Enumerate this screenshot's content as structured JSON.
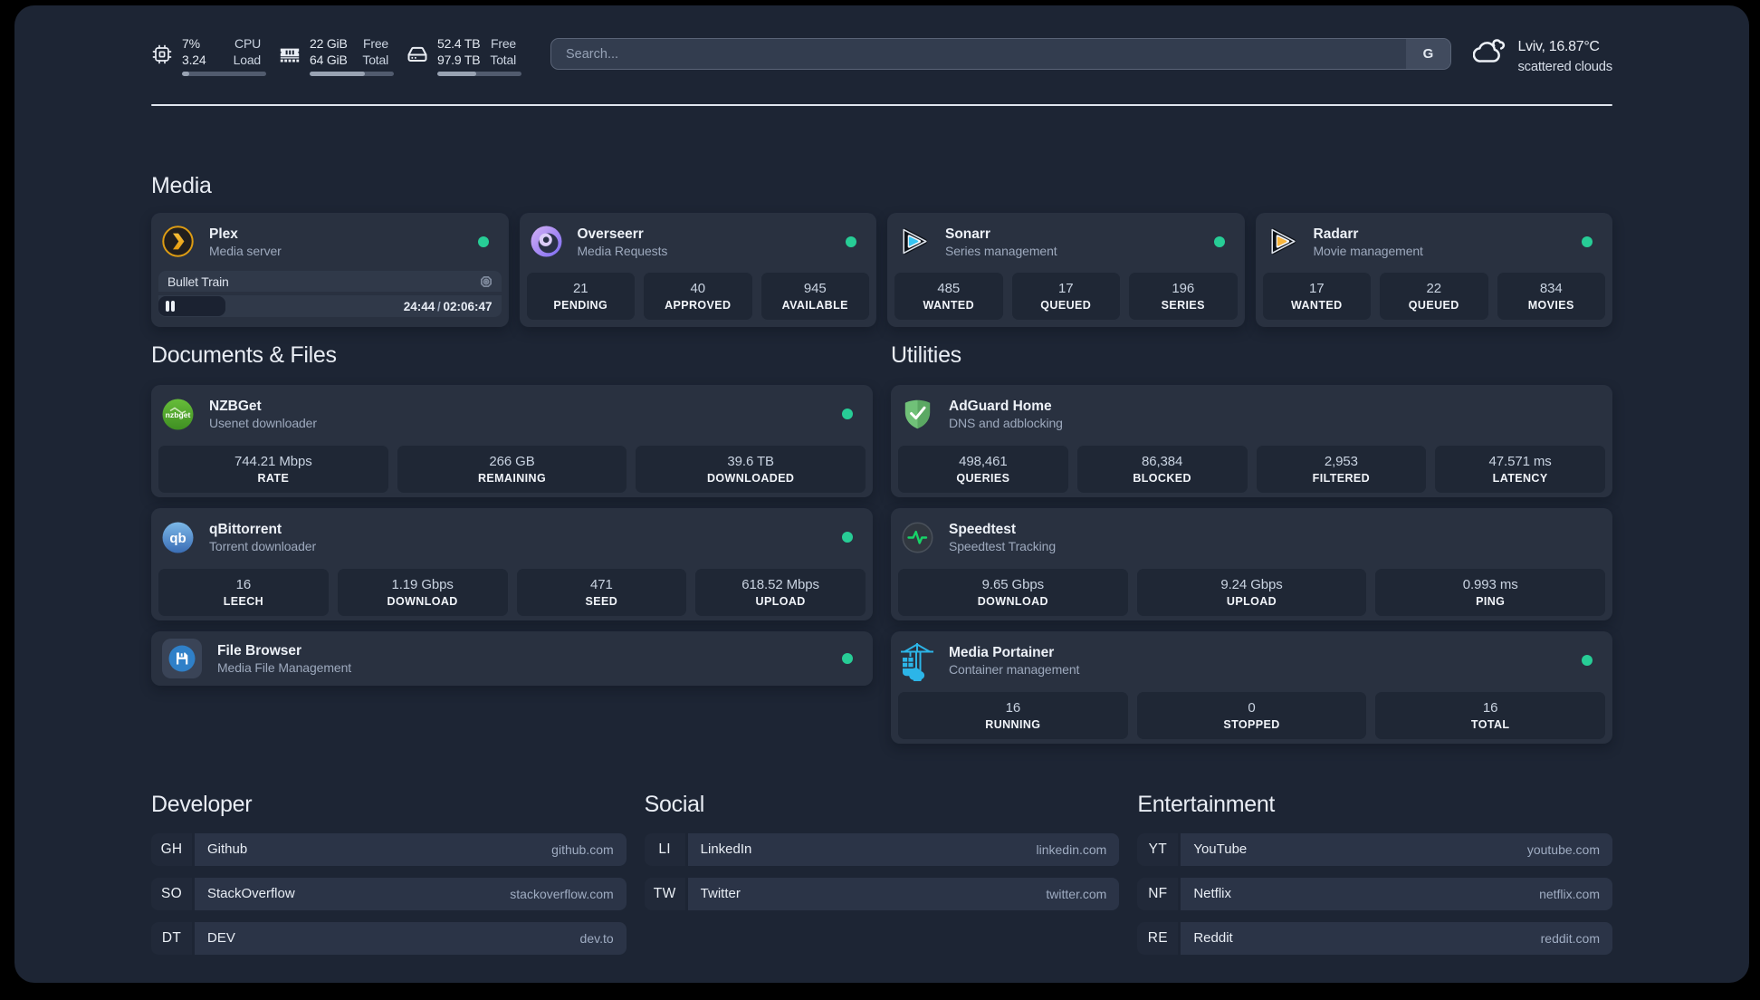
{
  "topbar": {
    "resources": [
      {
        "icon": "cpu-icon",
        "values": [
          "7%",
          "3.24"
        ],
        "labels": [
          "CPU",
          "Load"
        ],
        "progress_pct": 9
      },
      {
        "icon": "memory-icon",
        "values": [
          "22 GiB",
          "64 GiB"
        ],
        "labels": [
          "Free",
          "Total"
        ],
        "progress_pct": 66
      },
      {
        "icon": "disk-icon",
        "values": [
          "52.4 TB",
          "97.9 TB"
        ],
        "labels": [
          "Free",
          "Total"
        ],
        "progress_pct": 46
      }
    ],
    "search": {
      "placeholder": "Search...",
      "provider_button": "G"
    },
    "weather": {
      "location_temp": "Lviv, 16.87°C",
      "condition": "scattered clouds"
    }
  },
  "groups": {
    "media": {
      "title": "Media",
      "services": [
        {
          "name": "Plex",
          "description": "Media server",
          "icon": "plex-icon",
          "online": true,
          "player": {
            "title": "Bullet Train",
            "elapsed": "24:44",
            "separator": "/",
            "duration": "02:06:47",
            "progress_pct": 19.6
          }
        },
        {
          "name": "Overseerr",
          "description": "Media Requests",
          "icon": "overseerr-icon",
          "online": true,
          "stats": [
            {
              "value": "21",
              "label": "PENDING"
            },
            {
              "value": "40",
              "label": "APPROVED"
            },
            {
              "value": "945",
              "label": "AVAILABLE"
            }
          ]
        },
        {
          "name": "Sonarr",
          "description": "Series management",
          "icon": "sonarr-icon",
          "online": true,
          "stats": [
            {
              "value": "485",
              "label": "WANTED"
            },
            {
              "value": "17",
              "label": "QUEUED"
            },
            {
              "value": "196",
              "label": "SERIES"
            }
          ]
        },
        {
          "name": "Radarr",
          "description": "Movie management",
          "icon": "radarr-icon",
          "online": true,
          "stats": [
            {
              "value": "17",
              "label": "WANTED"
            },
            {
              "value": "22",
              "label": "QUEUED"
            },
            {
              "value": "834",
              "label": "MOVIES"
            }
          ]
        }
      ]
    },
    "documents": {
      "title": "Documents & Files",
      "services": [
        {
          "name": "NZBGet",
          "description": "Usenet downloader",
          "icon": "nzbget-icon",
          "online": true,
          "stats": [
            {
              "value": "744.21 Mbps",
              "label": "RATE"
            },
            {
              "value": "266 GB",
              "label": "REMAINING"
            },
            {
              "value": "39.6 TB",
              "label": "DOWNLOADED"
            }
          ]
        },
        {
          "name": "qBittorrent",
          "description": "Torrent downloader",
          "icon": "qbittorrent-icon",
          "online": true,
          "stats": [
            {
              "value": "16",
              "label": "LEECH"
            },
            {
              "value": "1.19 Gbps",
              "label": "DOWNLOAD"
            },
            {
              "value": "471",
              "label": "SEED"
            },
            {
              "value": "618.52 Mbps",
              "label": "UPLOAD"
            }
          ]
        },
        {
          "name": "File Browser",
          "description": "Media File Management",
          "icon": "filebrowser-icon",
          "online": true
        }
      ]
    },
    "utilities": {
      "title": "Utilities",
      "services": [
        {
          "name": "AdGuard Home",
          "description": "DNS and adblocking",
          "icon": "adguard-icon",
          "online": false,
          "stats": [
            {
              "value": "498,461",
              "label": "QUERIES"
            },
            {
              "value": "86,384",
              "label": "BLOCKED"
            },
            {
              "value": "2,953",
              "label": "FILTERED"
            },
            {
              "value": "47.571 ms",
              "label": "LATENCY"
            }
          ]
        },
        {
          "name": "Speedtest",
          "description": "Speedtest Tracking",
          "icon": "speedtest-icon",
          "online": false,
          "stats": [
            {
              "value": "9.65 Gbps",
              "label": "DOWNLOAD"
            },
            {
              "value": "9.24 Gbps",
              "label": "UPLOAD"
            },
            {
              "value": "0.993 ms",
              "label": "PING"
            }
          ]
        },
        {
          "name": "Media Portainer",
          "description": "Container management",
          "icon": "portainer-icon",
          "online": true,
          "stats": [
            {
              "value": "16",
              "label": "RUNNING"
            },
            {
              "value": "0",
              "label": "STOPPED"
            },
            {
              "value": "16",
              "label": "TOTAL"
            }
          ]
        }
      ]
    },
    "bookmarks": [
      {
        "title": "Developer",
        "links": [
          {
            "abbr": "GH",
            "name": "Github",
            "url": "github.com"
          },
          {
            "abbr": "SO",
            "name": "StackOverflow",
            "url": "stackoverflow.com"
          },
          {
            "abbr": "DT",
            "name": "DEV",
            "url": "dev.to"
          }
        ]
      },
      {
        "title": "Social",
        "links": [
          {
            "abbr": "LI",
            "name": "LinkedIn",
            "url": "linkedin.com"
          },
          {
            "abbr": "TW",
            "name": "Twitter",
            "url": "twitter.com"
          }
        ]
      },
      {
        "title": "Entertainment",
        "links": [
          {
            "abbr": "YT",
            "name": "YouTube",
            "url": "youtube.com"
          },
          {
            "abbr": "NF",
            "name": "Netflix",
            "url": "netflix.com"
          },
          {
            "abbr": "RE",
            "name": "Reddit",
            "url": "reddit.com"
          }
        ]
      }
    ]
  },
  "colors": {
    "status_online": "#27CD96",
    "background": "#1D2534",
    "card": "#293140"
  }
}
